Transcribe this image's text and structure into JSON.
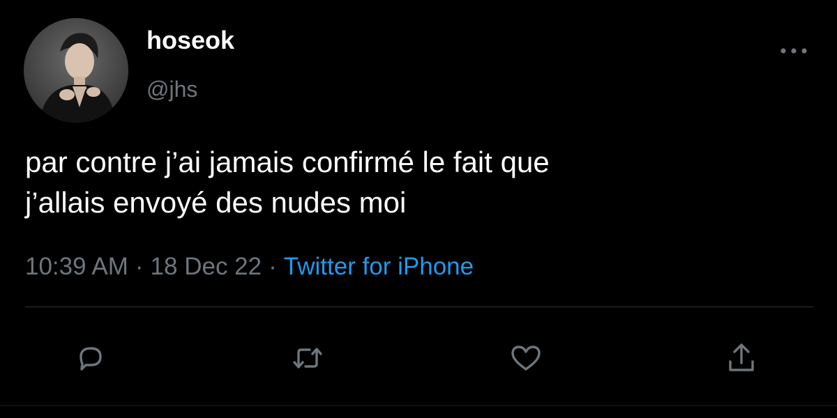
{
  "tweet": {
    "display_name": "hoseok",
    "handle": "@jhs",
    "text_lines": [
      "par contre j’ai jamais confirmé le fait que",
      "j’allais envoyé des nudes moi"
    ],
    "time": "10:39 AM",
    "separator": "·",
    "date": "18 Dec 22",
    "source": "Twitter for iPhone"
  },
  "icons": {
    "more": "more-horizontal-icon",
    "reply": "reply-bubble-icon",
    "retweet": "retweet-arrows-icon",
    "like": "heart-icon",
    "share": "share-upload-icon"
  },
  "colors": {
    "background": "#000000",
    "text_primary": "#ffffff",
    "text_secondary": "#6e767d",
    "link": "#1d9bf0",
    "divider": "#2f3336"
  }
}
